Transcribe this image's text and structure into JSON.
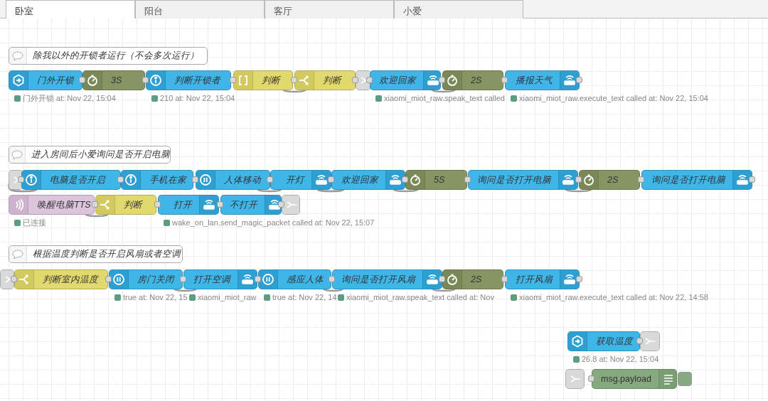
{
  "tabs": [
    {
      "label": "卧室",
      "selected": true
    },
    {
      "label": "阳台",
      "selected": false
    },
    {
      "label": "客厅",
      "selected": false
    },
    {
      "label": "小爱",
      "selected": false
    }
  ],
  "flows": [
    {
      "comment": "除我以外的开锁者运行（不会多次运行）",
      "chains": [
        {
          "nodes": [
            {
              "kind": "trigger",
              "label": "门外开锁",
              "status": "门外开锁 at: Nov 22, 15:04"
            },
            {
              "kind": "delay",
              "label": "3S"
            },
            {
              "kind": "state",
              "label": "判断开锁者",
              "status": "210 at: Nov 22, 15:04"
            },
            {
              "kind": "filter",
              "label": "判断"
            },
            {
              "kind": "switch",
              "label": "判断"
            },
            {
              "kind": "link"
            },
            {
              "kind": "service",
              "label": "欢迎回家",
              "status": "xiaomi_miot_raw.speak_text called"
            },
            {
              "kind": "delay",
              "label": "2S"
            },
            {
              "kind": "service",
              "label": "播报天气",
              "status": "xiaomi_miot_raw.execute_text called at: Nov 22, 15:04"
            }
          ]
        }
      ]
    },
    {
      "comment": "进入房间后小爱询问是否开启电脑",
      "chains": [
        {
          "nodes": [
            {
              "kind": "link"
            },
            {
              "kind": "state",
              "label": "电脑是否开启"
            },
            {
              "kind": "state",
              "label": "手机在家"
            },
            {
              "kind": "wait",
              "label": "人体移动"
            },
            {
              "kind": "service",
              "label": "开灯"
            },
            {
              "kind": "service",
              "label": "欢迎回家"
            },
            {
              "kind": "delay",
              "label": "5S"
            },
            {
              "kind": "service",
              "label": "询问是否打开电脑"
            },
            {
              "kind": "delay",
              "label": "2S"
            },
            {
              "kind": "service",
              "label": "询问是否打开电脑"
            }
          ]
        },
        {
          "nodes": [
            {
              "kind": "events",
              "label": "唤醒电脑TTS",
              "status": "已连接"
            },
            {
              "kind": "switch",
              "label": "判断"
            },
            {
              "kind": "service",
              "label": "打开",
              "status": "wake_on_lan.send_magic_packet called at: Nov 22, 15:07"
            },
            {
              "kind": "service",
              "label": "不打开"
            },
            {
              "kind": "link"
            }
          ]
        }
      ]
    },
    {
      "comment": "根据温度判断是否开启风扇或者空调",
      "chains": [
        {
          "nodes": [
            {
              "kind": "link"
            },
            {
              "kind": "switch",
              "label": "判断室内温度"
            },
            {
              "kind": "wait",
              "label": "房门关闭",
              "status": "true at: Nov 22, 15"
            },
            {
              "kind": "service",
              "label": "打开空调",
              "status": "xiaomi_miot_raw"
            },
            {
              "kind": "wait",
              "label": "感应人体",
              "status": "true at: Nov 22, 14"
            },
            {
              "kind": "service",
              "label": "询问是否打开风扇",
              "status": "xiaomi_miot_raw.speak_text called at: Nov"
            },
            {
              "kind": "delay",
              "label": "2S"
            },
            {
              "kind": "service",
              "label": "打开风扇",
              "status": "xiaomi_miot_raw.execute_text called at: Nov 22, 14:58"
            }
          ]
        }
      ]
    },
    {
      "chains": [
        {
          "nodes": [
            {
              "kind": "trigger",
              "label": "获取温度",
              "status": "26.8 at: Nov 22, 15:04"
            },
            {
              "kind": "link"
            }
          ]
        },
        {
          "nodes": [
            {
              "kind": "link"
            },
            {
              "kind": "debug",
              "label": "msg.payload"
            }
          ]
        }
      ]
    }
  ]
}
